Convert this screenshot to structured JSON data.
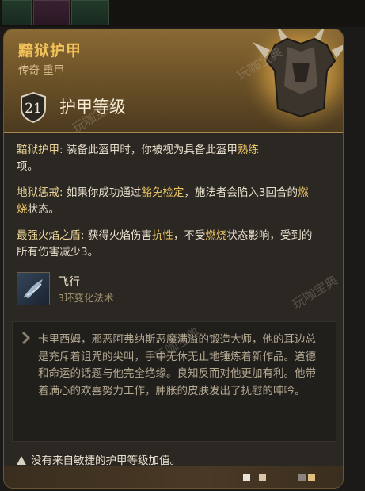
{
  "item": {
    "name": "黯狱护甲",
    "subtitle": "传奇 重甲",
    "armor_class": "21",
    "armor_class_label": "护甲等级"
  },
  "properties": [
    {
      "title": "黯狱护甲:",
      "text": " 装备此盔甲时，你被视为具备此盔甲",
      "keyword": "熟练",
      "tail": "项。"
    },
    {
      "title": "地狱惩戒:",
      "text": " 如果你成功通过",
      "keyword": "豁免检定",
      "tail": "，施法者会陷入3回合的",
      "keyword2": "燃烧",
      "tail2": "状态。"
    },
    {
      "title": "最强火焰之盾:",
      "text": " 获得火焰伤害",
      "keyword": "抗性",
      "tail": "，不受",
      "keyword2": "燃烧",
      "tail2": "状态影响，受到的所有伤害减少3。"
    }
  ],
  "spell": {
    "name": "飞行",
    "subtitle": "3环变化法术",
    "icon": "flight-spell-icon"
  },
  "flavor_text": "卡里西姆，邪恶阿弗纳斯恶魔满溢的锻造大师，他的耳边总是充斥着诅咒的尖叫，手中无休无止地锤炼着新作品。道德和命运的话题与他完全绝缘。良知反而对他更加有利。他带着满心的欢喜努力工作，肿胀的皮肤发出了抚慰的呻吟。",
  "warning": "没有来自敏捷的护甲等级加值。",
  "watermark": "玩咖宝典",
  "colors": {
    "title_gold": "#f2c25a",
    "header_bg": "#8a6a34",
    "body_bg": "#2b2823",
    "keyword": "#efd79a"
  }
}
